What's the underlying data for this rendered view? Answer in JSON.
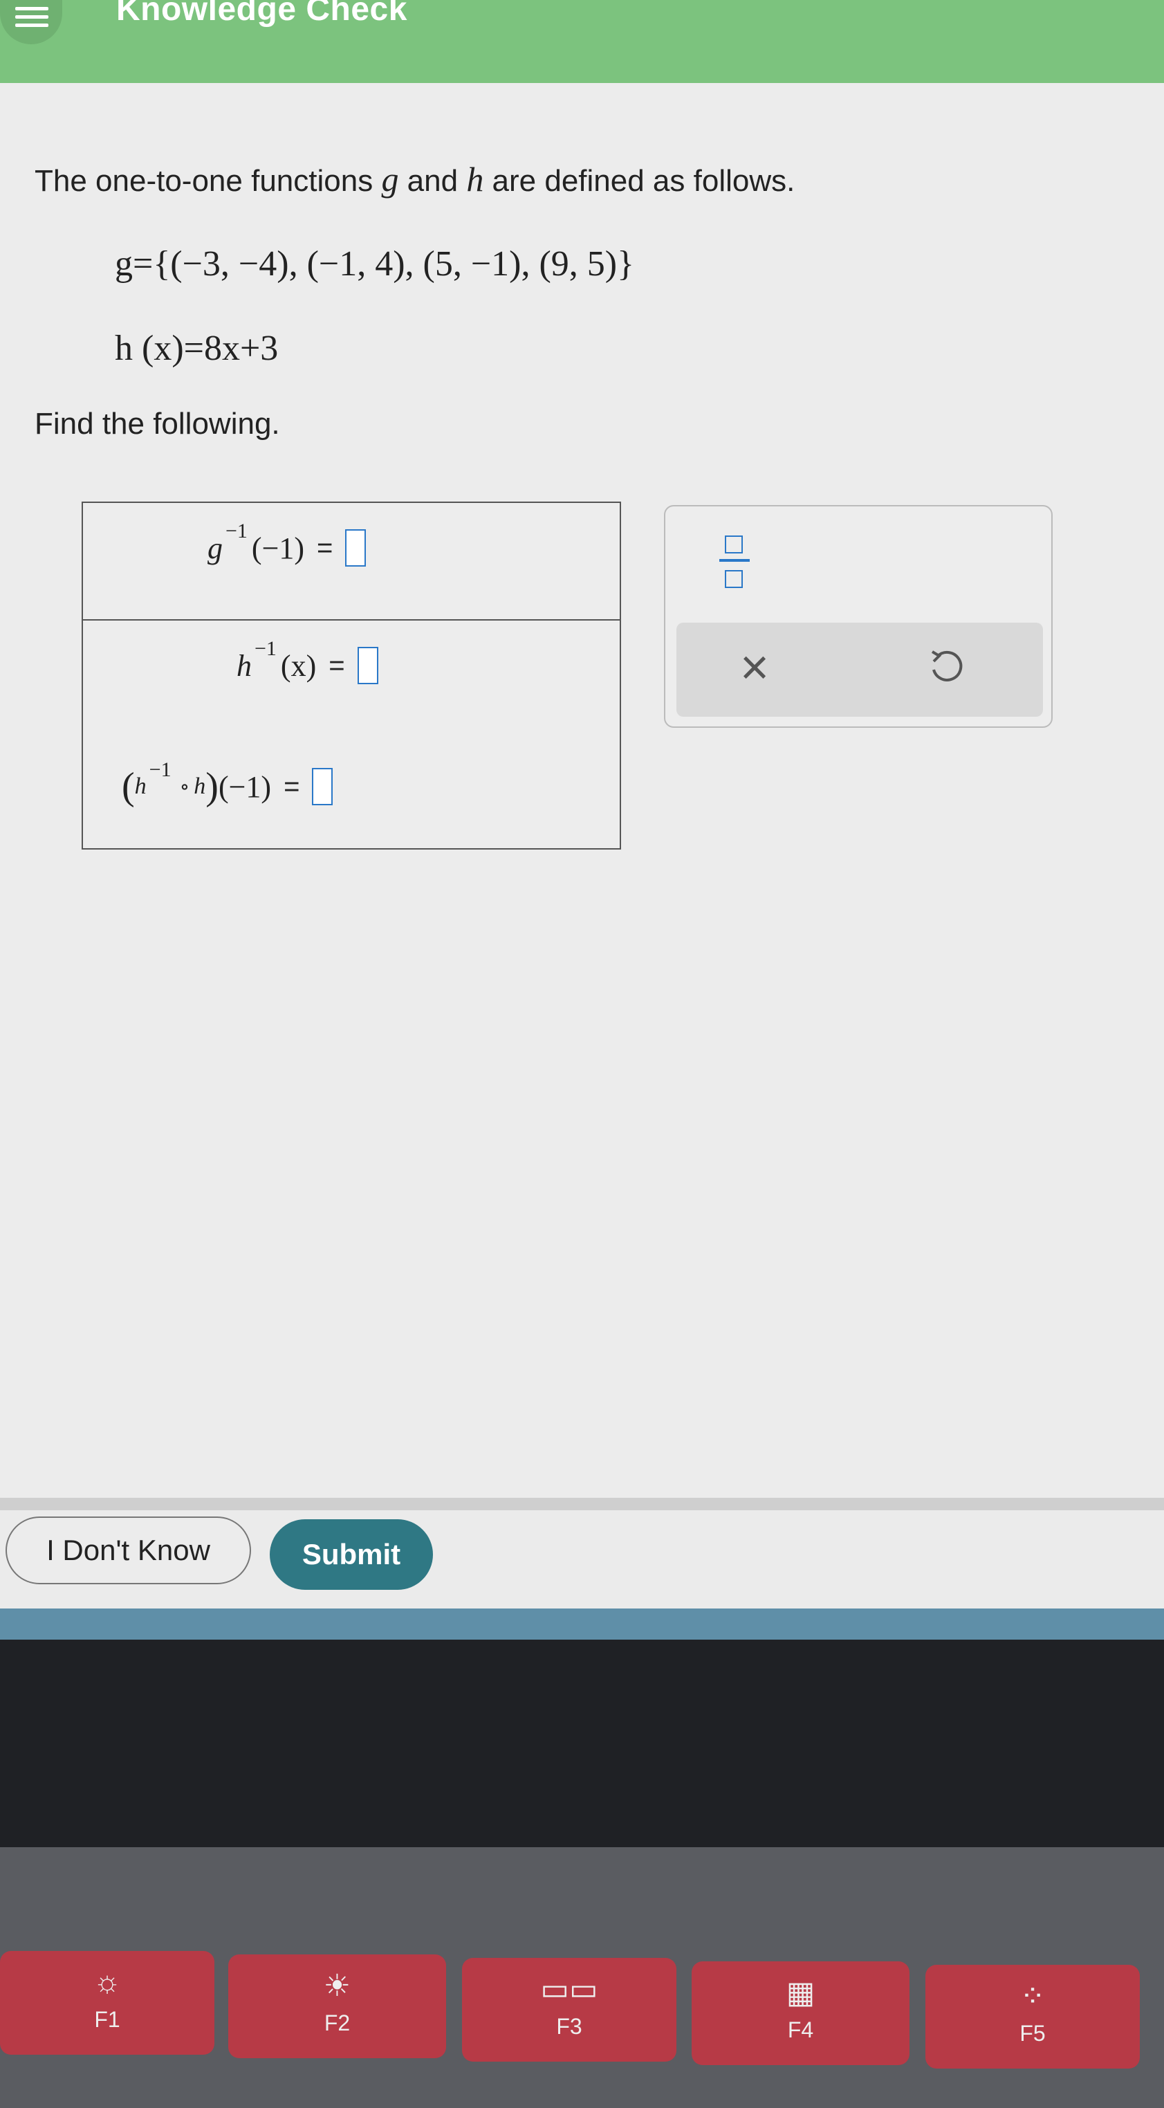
{
  "header": {
    "title": "Knowledge Check"
  },
  "problem": {
    "intro_before": "The one-to-one functions ",
    "var_g": "g",
    "intro_and": " and ",
    "var_h": "h",
    "intro_after": " are defined as follows.",
    "g_definition": "g={(−3, −4), (−1, 4), (5, −1), (9, 5)}",
    "h_definition": "h (x)=8x+3",
    "find_text": "Find the following."
  },
  "answers": {
    "rows": [
      {
        "fn": "g",
        "sup": "−1",
        "arg": "(−1)",
        "equals": "="
      },
      {
        "fn": "h",
        "sup": "−1",
        "arg": "(x)",
        "equals": "="
      },
      {
        "open": "(",
        "fn": "h",
        "sup": "−1",
        "compose": "∘",
        "fn2": "h",
        "close": ")",
        "arg": "(−1)",
        "equals": "="
      }
    ]
  },
  "tools": {
    "clear_symbol": "×"
  },
  "buttons": {
    "dont_know": "I Don't Know",
    "submit": "Submit"
  },
  "keyboard": {
    "keys": [
      {
        "label": "F1",
        "icon": "☼"
      },
      {
        "label": "F2",
        "icon": "☀"
      },
      {
        "label": "F3",
        "icon": "▭▭"
      },
      {
        "label": "F4",
        "icon": "▦"
      },
      {
        "label": "F5",
        "icon": "⁘"
      }
    ]
  },
  "colors": {
    "header": "#7cc37e",
    "submit": "#2f7884",
    "input_box": "#2a78c8"
  }
}
